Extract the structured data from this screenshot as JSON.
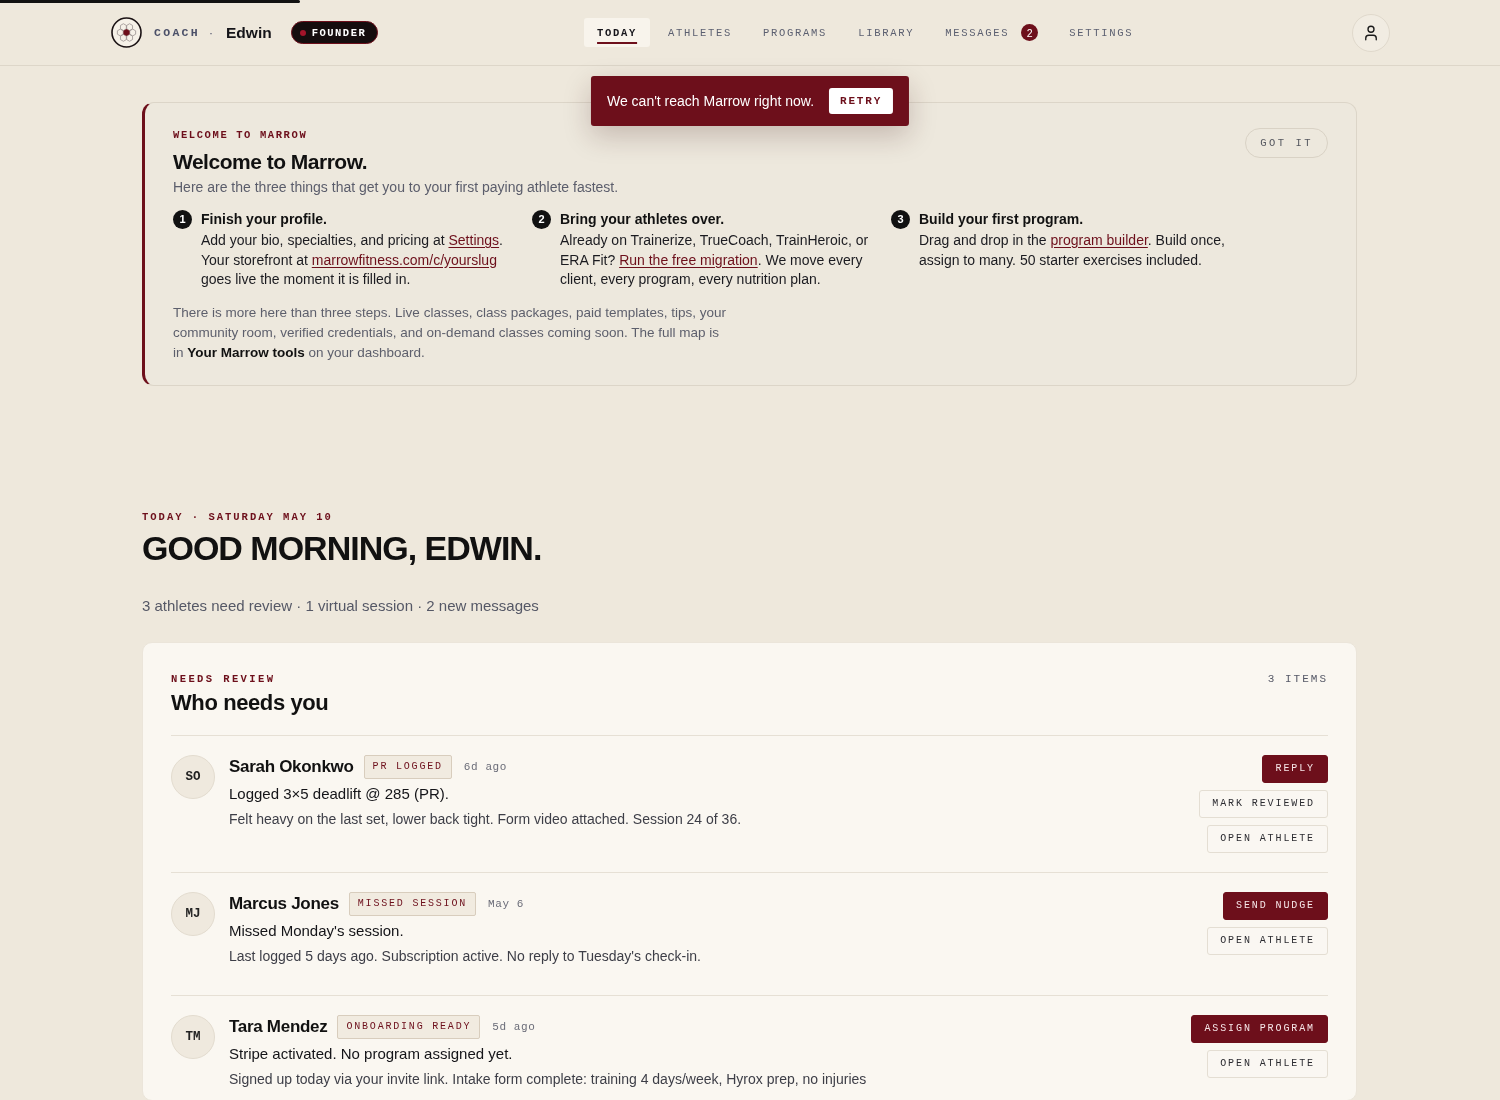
{
  "loading_bar": {
    "level": 0.2
  },
  "header": {
    "role": "COACH",
    "separator": "·",
    "user": "Edwin",
    "badge": "FOUNDER",
    "nav": [
      {
        "label": "TODAY",
        "selected": true
      },
      {
        "label": "ATHLETES",
        "selected": false
      },
      {
        "label": "PROGRAMS",
        "selected": false
      },
      {
        "label": "LIBRARY",
        "selected": false
      },
      {
        "label": "MESSAGES",
        "selected": false,
        "count": "2"
      },
      {
        "label": "SETTINGS",
        "selected": false
      }
    ]
  },
  "toast": {
    "message": "We can't reach Marrow right now.",
    "action": "RETRY"
  },
  "welcome": {
    "eyebrow": "WELCOME TO MARROW",
    "title": "Welcome to Marrow.",
    "subtitle": "Here are the three things that get you to your first paying athlete fastest.",
    "dismiss": "GOT IT",
    "steps": [
      {
        "number": "1",
        "title": "Finish your profile.",
        "body": [
          {
            "kind": "text",
            "text": "Add your bio, specialties, and pricing at "
          },
          {
            "kind": "link",
            "text": "Settings"
          },
          {
            "kind": "text",
            "text": ". Your storefront at "
          },
          {
            "kind": "link",
            "text": "marrowfitness.com/c/yourslug"
          },
          {
            "kind": "text",
            "text": " goes live the moment it is filled in."
          }
        ]
      },
      {
        "number": "2",
        "title": "Bring your athletes over.",
        "body": [
          {
            "kind": "text",
            "text": "Already on Trainerize, TrueCoach, TrainHeroic, or ERA Fit? "
          },
          {
            "kind": "link",
            "text": "Run the free migration"
          },
          {
            "kind": "text",
            "text": ". We move every client, every program, every nutrition plan."
          }
        ]
      },
      {
        "number": "3",
        "title": "Build your first program.",
        "body": [
          {
            "kind": "text",
            "text": "Drag and drop in the "
          },
          {
            "kind": "link",
            "text": "program builder"
          },
          {
            "kind": "text",
            "text": ". Build once, assign to many. 50 starter exercises included."
          }
        ]
      }
    ],
    "footnote": "There is more here than three steps. Live classes, class packages, paid templates, tips, your community room, verified credentials, and on-demand classes coming soon. The full map is in **Your Marrow tools** on your dashboard."
  },
  "today": {
    "eyebrow": "TODAY · SATURDAY MAY 10",
    "greeting": "GOOD MORNING, EDWIN.",
    "summary": "3 athletes need review · 1 virtual session · 2 new messages"
  },
  "review": {
    "eyebrow": "NEEDS REVIEW",
    "count": "3 ITEMS",
    "title": "Who needs you",
    "items": [
      {
        "initials": "SO",
        "name": "Sarah Okonkwo",
        "tag": "PR LOGGED",
        "time": "6d ago",
        "headline": "Logged 3×5 deadlift @ 285 (PR).",
        "detail": "Felt heavy on the last set, lower back tight. Form video attached. Session 24 of 36.",
        "actions": [
          {
            "label": "REPLY",
            "kind": "primary"
          },
          {
            "label": "MARK REVIEWED",
            "kind": "secondary"
          },
          {
            "label": "OPEN ATHLETE",
            "kind": "secondary"
          }
        ]
      },
      {
        "initials": "MJ",
        "name": "Marcus Jones",
        "tag": "MISSED SESSION",
        "time": "May 6",
        "headline": "Missed Monday's session.",
        "detail": "Last logged 5 days ago. Subscription active. No reply to Tuesday's check-in.",
        "actions": [
          {
            "label": "SEND NUDGE",
            "kind": "primary"
          },
          {
            "label": "OPEN ATHLETE",
            "kind": "secondary"
          }
        ]
      },
      {
        "initials": "TM",
        "name": "Tara Mendez",
        "tag": "ONBOARDING READY",
        "time": "5d ago",
        "headline": "Stripe activated. No program assigned yet.",
        "detail": "Signed up today via your invite link. Intake form complete: training 4 days/week, Hyrox prep, no injuries",
        "actions": [
          {
            "label": "ASSIGN PROGRAM",
            "kind": "primary"
          },
          {
            "label": "OPEN ATHLETE",
            "kind": "secondary"
          }
        ]
      }
    ]
  }
}
